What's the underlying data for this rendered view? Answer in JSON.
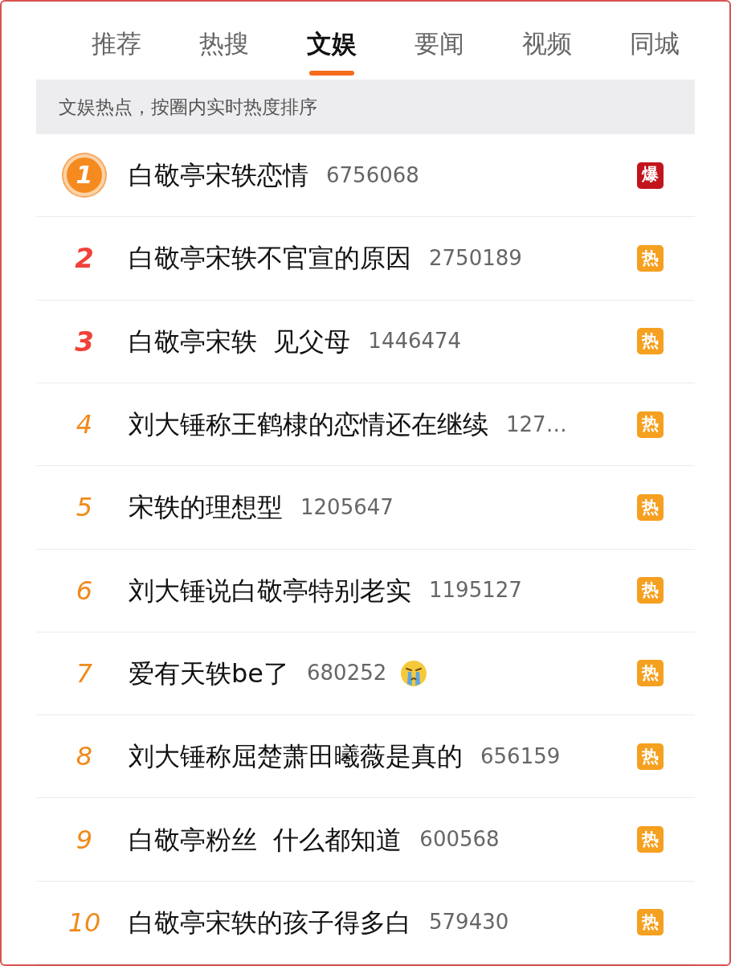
{
  "tabs": [
    {
      "label": "推荐",
      "selected": false
    },
    {
      "label": "热搜",
      "selected": false
    },
    {
      "label": "文娱",
      "selected": true
    },
    {
      "label": "要闻",
      "selected": false
    },
    {
      "label": "视频",
      "selected": false
    },
    {
      "label": "同城",
      "selected": false
    }
  ],
  "notice": "文娱热点，按圈内实时热度排序",
  "rows": [
    {
      "rank": "1",
      "kind": "medal",
      "title": "白敬亭宋轶恋情",
      "count": "6756068",
      "emoji": false,
      "badge": {
        "text": "爆",
        "color": "#c1141c"
      }
    },
    {
      "rank": "2",
      "kind": "top",
      "title": "白敬亭宋轶不官宣的原因",
      "count": "2750189",
      "emoji": false,
      "badge": {
        "text": "热",
        "color": "#f5a021"
      }
    },
    {
      "rank": "3",
      "kind": "top",
      "title": "白敬亭宋轶  见父母",
      "count": "1446474",
      "emoji": false,
      "badge": {
        "text": "热",
        "color": "#f5a021"
      }
    },
    {
      "rank": "4",
      "kind": "normal",
      "title": "刘大锤称王鹤棣的恋情还在继续",
      "count": "127…",
      "emoji": false,
      "badge": {
        "text": "热",
        "color": "#f5a021"
      }
    },
    {
      "rank": "5",
      "kind": "normal",
      "title": "宋轶的理想型",
      "count": "1205647",
      "emoji": false,
      "badge": {
        "text": "热",
        "color": "#f5a021"
      }
    },
    {
      "rank": "6",
      "kind": "normal",
      "title": "刘大锤说白敬亭特别老实",
      "count": "1195127",
      "emoji": false,
      "badge": {
        "text": "热",
        "color": "#f5a021"
      }
    },
    {
      "rank": "7",
      "kind": "normal",
      "title": "爱有天轶be了",
      "count": "680252",
      "emoji": true,
      "badge": {
        "text": "热",
        "color": "#f5a021"
      }
    },
    {
      "rank": "8",
      "kind": "normal",
      "title": "刘大锤称屈楚萧田曦薇是真的",
      "count": "656159",
      "emoji": false,
      "badge": {
        "text": "热",
        "color": "#f5a021"
      }
    },
    {
      "rank": "9",
      "kind": "normal",
      "title": "白敬亭粉丝  什么都知道",
      "count": "600568",
      "emoji": false,
      "badge": {
        "text": "热",
        "color": "#f5a021"
      }
    },
    {
      "rank": "10",
      "kind": "normal",
      "title": "白敬亭宋轶的孩子得多白",
      "count": "579430",
      "emoji": false,
      "badge": {
        "text": "热",
        "color": "#f5a021"
      }
    }
  ]
}
